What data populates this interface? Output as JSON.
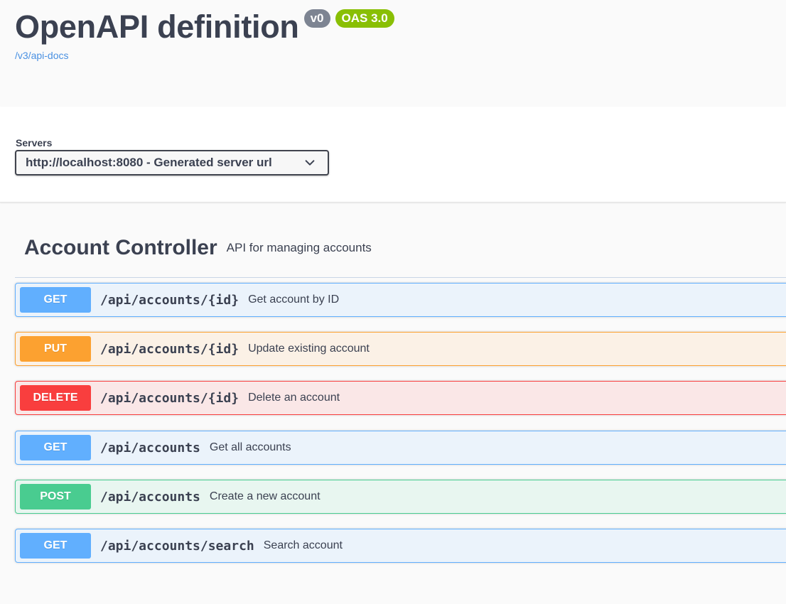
{
  "info": {
    "title": "OpenAPI definition",
    "version": "v0",
    "oas": "OAS 3.0",
    "spec_url": "/v3/api-docs"
  },
  "servers": {
    "label": "Servers",
    "selected": "http://localhost:8080 - Generated server url"
  },
  "tag": {
    "name": "Account Controller",
    "description": "API for managing accounts"
  },
  "operations": [
    {
      "method": "GET",
      "path": "/api/accounts/{id}",
      "summary": "Get account by ID"
    },
    {
      "method": "PUT",
      "path": "/api/accounts/{id}",
      "summary": "Update existing account"
    },
    {
      "method": "DELETE",
      "path": "/api/accounts/{id}",
      "summary": "Delete an account"
    },
    {
      "method": "GET",
      "path": "/api/accounts",
      "summary": "Get all accounts"
    },
    {
      "method": "POST",
      "path": "/api/accounts",
      "summary": "Create a new account"
    },
    {
      "method": "GET",
      "path": "/api/accounts/search",
      "summary": "Search account"
    }
  ],
  "colors": {
    "get": "#61affe",
    "put": "#fca130",
    "delete": "#f93e3e",
    "post": "#49cc90",
    "link": "#4990e2",
    "oas_badge": "#89bf04",
    "version_badge": "#7d8492"
  },
  "icons": {
    "server_dropdown": "chevron-down-icon"
  }
}
